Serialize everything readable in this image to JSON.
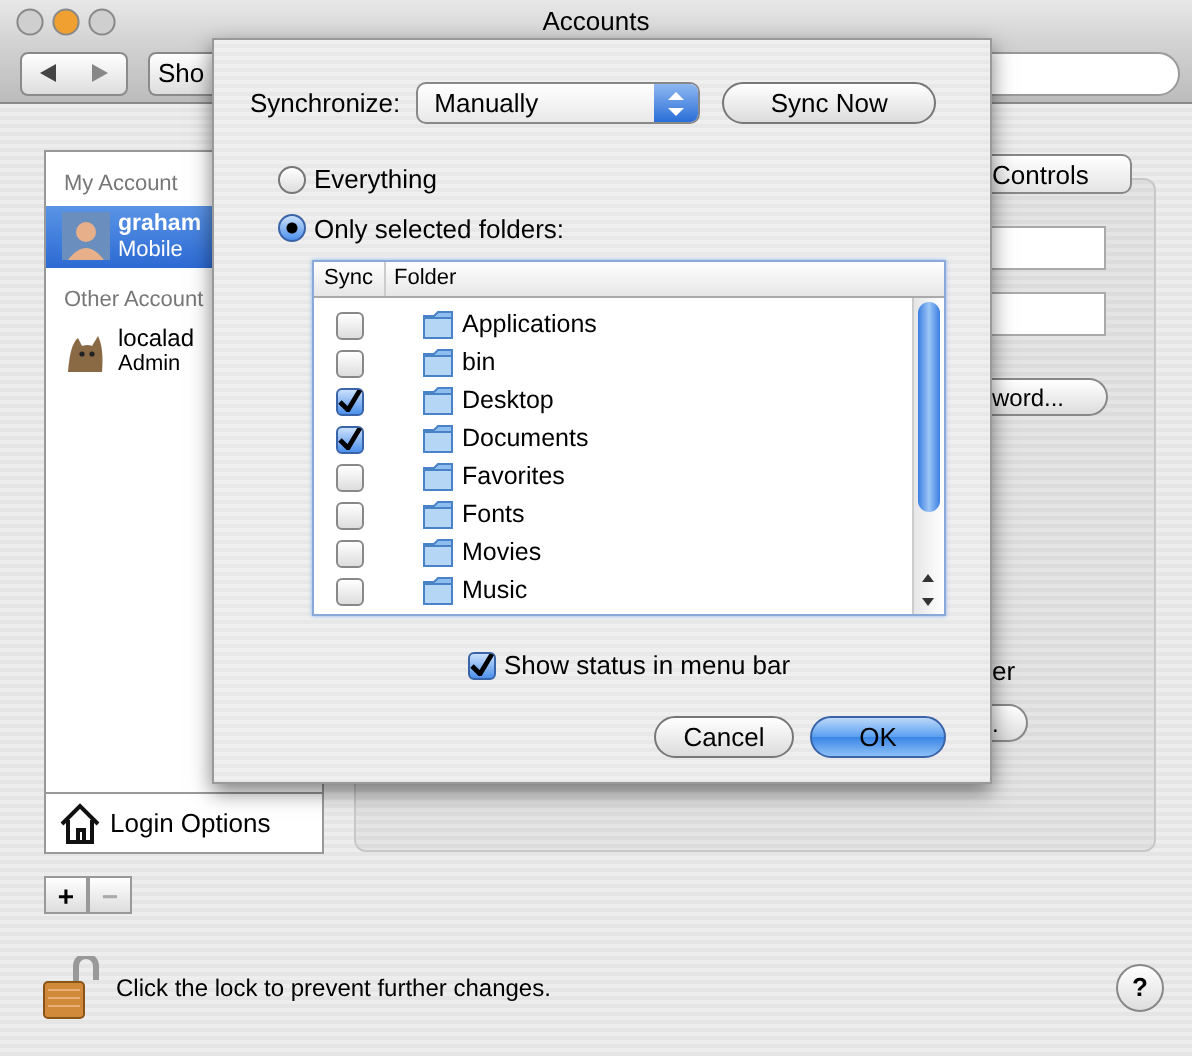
{
  "window": {
    "title": "Accounts"
  },
  "toolbar": {
    "show_all_button": "Sho"
  },
  "accounts_list": {
    "sections": [
      {
        "header": "My Account",
        "accounts": [
          {
            "name": "graham",
            "role": "Mobile",
            "selected": true,
            "kind": "person"
          }
        ]
      },
      {
        "header": "Other Account",
        "accounts": [
          {
            "name": "localad",
            "role": "Admin",
            "selected": false,
            "kind": "cat"
          }
        ]
      }
    ],
    "login_options": "Login Options"
  },
  "account_buttons": [
    {
      "label": "+",
      "disabled": false
    },
    {
      "label": "−",
      "disabled": true
    }
  ],
  "panel": {
    "tab": "Controls",
    "button": "word...",
    "text_fragment": "er",
    "button_fragment": "."
  },
  "sheet": {
    "sync_label": "Synchronize:",
    "sync_mode": "Manually",
    "sync_now": "Sync Now",
    "options": [
      {
        "label": "Everything",
        "selected": false
      },
      {
        "label": "Only selected folders:",
        "selected": true
      }
    ],
    "columns": [
      "Sync",
      "Folder"
    ],
    "folders": [
      {
        "name": "Applications",
        "checked": false
      },
      {
        "name": "bin",
        "checked": false
      },
      {
        "name": "Desktop",
        "checked": true
      },
      {
        "name": "Documents",
        "checked": true
      },
      {
        "name": "Favorites",
        "checked": false
      },
      {
        "name": "Fonts",
        "checked": false
      },
      {
        "name": "Movies",
        "checked": false
      },
      {
        "name": "Music",
        "checked": false
      }
    ],
    "show_status": {
      "label": "Show status in menu bar",
      "checked": true
    },
    "buttons": [
      {
        "label": "Cancel",
        "kind": "secondary"
      },
      {
        "label": "OK",
        "kind": "default"
      }
    ]
  },
  "lock": {
    "text": "Click the lock to prevent further changes."
  },
  "help": "?"
}
